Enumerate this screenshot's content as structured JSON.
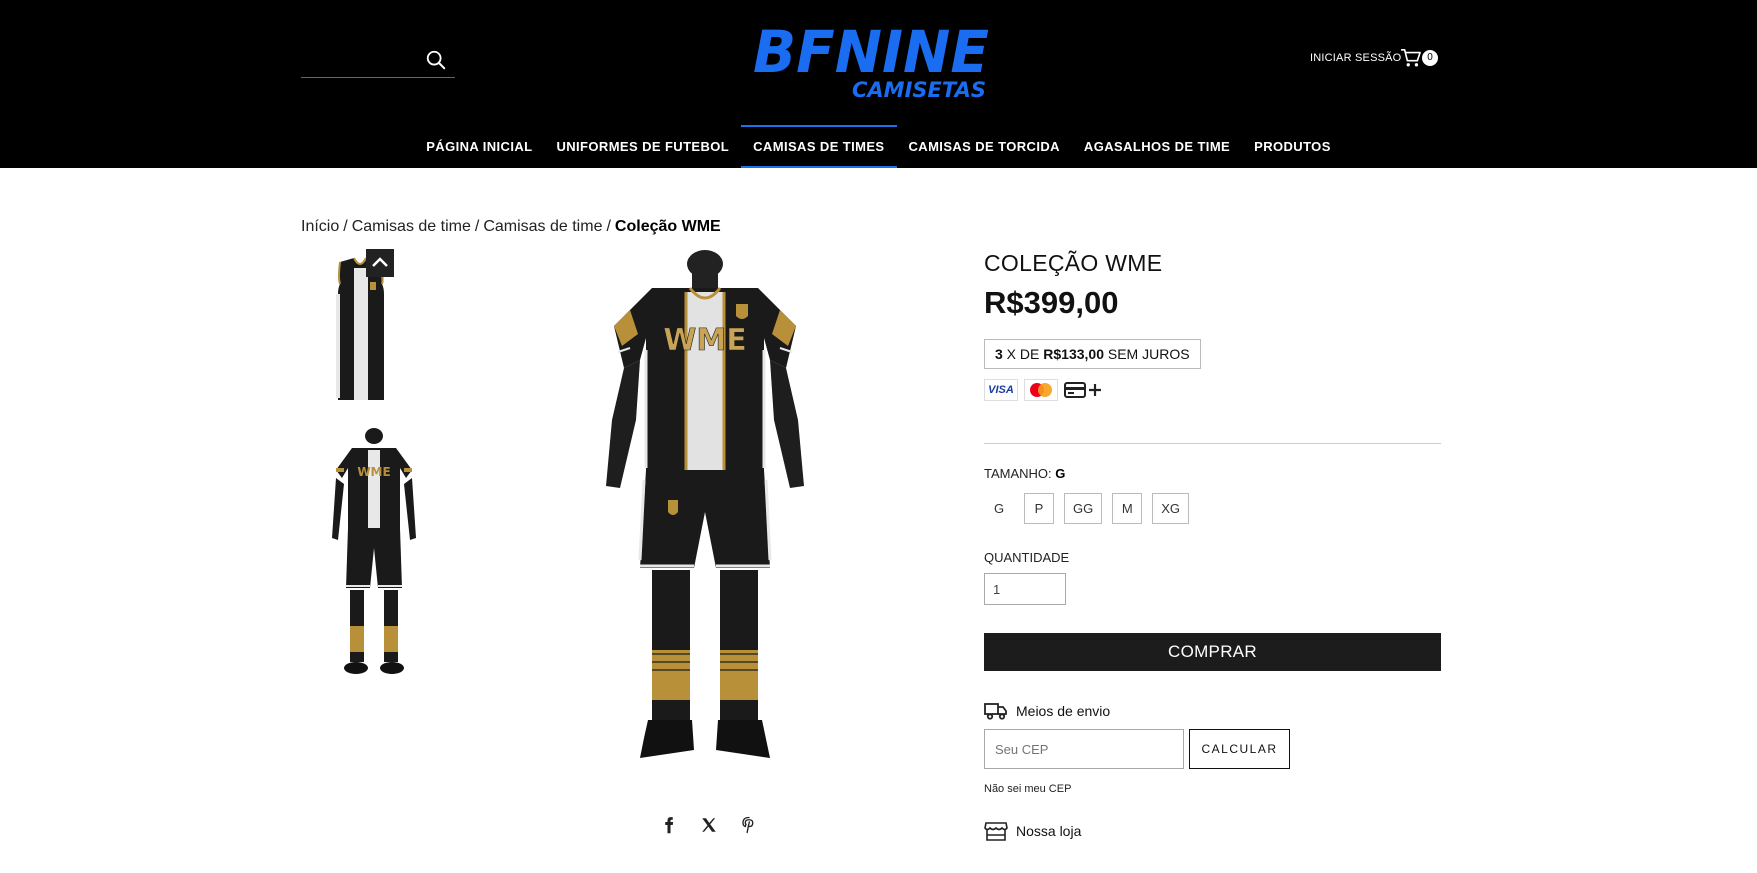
{
  "header": {
    "search": {
      "placeholder": "",
      "icon": "search-icon"
    },
    "logo": {
      "line1": "BFNINE",
      "line2": "CAMISETAS",
      "color": "#1a6cf0"
    },
    "login_label": "INICIAR SESSÃO",
    "cart": {
      "icon": "cart-icon",
      "count": "0"
    }
  },
  "nav": {
    "items": [
      {
        "label": "PÁGINA INICIAL"
      },
      {
        "label": "UNIFORMES DE FUTEBOL"
      },
      {
        "label": "CAMISAS DE TIMES",
        "active": true
      },
      {
        "label": "CAMISAS DE TORCIDA"
      },
      {
        "label": "AGASALHOS DE TIME"
      },
      {
        "label": "PRODUTOS"
      }
    ],
    "active_color": "#1a73e8"
  },
  "breadcrumb": {
    "items": [
      "Início",
      "Camisas de time",
      "Camisas de time"
    ],
    "separator": "/",
    "current": "Coleção WME"
  },
  "gallery": {
    "jersey_text": "WME",
    "colors": {
      "black": "#1a1a1a",
      "gold": "#b8903a",
      "white": "#e8e8e8"
    }
  },
  "share": {
    "icons": [
      "facebook-icon",
      "x-icon",
      "pinterest-icon"
    ]
  },
  "product": {
    "title": "COLEÇÃO WME",
    "price": "R$399,00",
    "installments": {
      "count": "3",
      "middle": " X DE ",
      "value": "R$133,00",
      "suffix": " SEM JUROS"
    },
    "payment_methods": {
      "visa": "VISA",
      "icons": [
        "visa-icon",
        "mastercard-icon",
        "card-icon",
        "plus-icon"
      ]
    },
    "size": {
      "label": "TAMANHO: ",
      "selected": "G",
      "options": [
        "G",
        "P",
        "GG",
        "M",
        "XG"
      ]
    },
    "quantity": {
      "label": "QUANTIDADE",
      "value": "1"
    },
    "buy_label": "COMPRAR",
    "shipping": {
      "label": "Meios de envio",
      "cep_placeholder": "Seu CEP",
      "calc_label": "CALCULAR",
      "no_cep_label": "Não sei meu CEP"
    },
    "store_label": "Nossa loja"
  }
}
